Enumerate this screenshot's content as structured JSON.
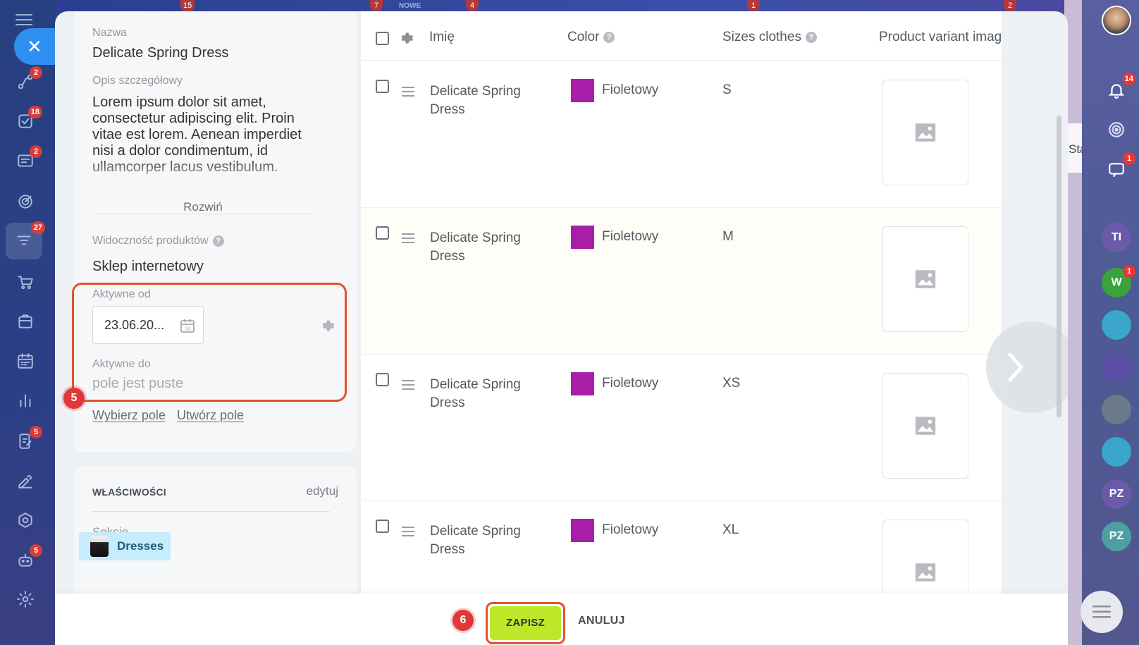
{
  "top_strip": {
    "badges": [
      "15",
      "7",
      "4",
      "1",
      "2"
    ],
    "new_label": "NOWE"
  },
  "left_rail": {
    "items": [
      {
        "icon": "deals-icon",
        "badge": "2"
      },
      {
        "icon": "tasks-icon",
        "badge": "18"
      },
      {
        "icon": "feed-icon",
        "badge": "2"
      },
      {
        "icon": "target-icon",
        "badge": ""
      },
      {
        "icon": "funnel-icon",
        "badge": "27"
      },
      {
        "icon": "cart-icon",
        "badge": ""
      },
      {
        "icon": "store-icon",
        "badge": ""
      },
      {
        "icon": "calendar-icon",
        "badge": ""
      },
      {
        "icon": "analytics-icon",
        "badge": ""
      },
      {
        "icon": "edit-doc-icon",
        "badge": "5"
      },
      {
        "icon": "sign-icon",
        "badge": ""
      },
      {
        "icon": "hexagon-icon",
        "badge": ""
      },
      {
        "icon": "robot-icon",
        "badge": "5"
      },
      {
        "icon": "settings-icon",
        "badge": ""
      }
    ]
  },
  "right_rail": {
    "notification_badge": "14",
    "chat_badge": "1",
    "behind_text": "Stawka poda",
    "avatars": [
      {
        "initials": "TI",
        "color": "#6a5aa8",
        "badge": ""
      },
      {
        "initials": "W",
        "color": "#3aa33a",
        "badge": "1"
      },
      {
        "initials": "",
        "color": "#3aa6c9",
        "badge": ""
      },
      {
        "initials": "",
        "color": "#5b4fa8",
        "badge": ""
      },
      {
        "initials": "",
        "color": "#6b7a8a",
        "badge": ""
      },
      {
        "initials": "",
        "color": "#3aa6c9",
        "badge": ""
      },
      {
        "initials": "PZ",
        "color": "#6a5aa8",
        "badge": ""
      },
      {
        "initials": "PZ",
        "color": "#4d9fa3",
        "badge": ""
      }
    ]
  },
  "product": {
    "name_label": "Nazwa",
    "name_value": "Delicate Spring Dress",
    "desc_label": "Opis szczegółowy",
    "desc_value": "Lorem ipsum dolor sit amet, consectetur adipiscing elit. Proin vitae est lorem. Aenean imperdiet nisi a dolor condimentum, id ullamcorper lacus vestibulum.",
    "expand": "Rozwiń",
    "visibility_label": "Widoczność produktów",
    "visibility_value": "Sklep internetowy",
    "active_from_label": "Aktywne od",
    "active_from_value": "23.06.20...",
    "active_to_label": "Aktywne do",
    "active_to_placeholder": "pole jest puste",
    "choose_field": "Wybierz pole",
    "create_field": "Utwórz pole",
    "step_5": "5"
  },
  "properties": {
    "title": "WŁAŚCIWOŚCI",
    "edit": "edytuj",
    "sections_label": "Sekcje",
    "section_tag": "Dresses"
  },
  "table": {
    "columns": [
      "Imię",
      "Color",
      "Sizes clothes",
      "Product variant images"
    ],
    "rows": [
      {
        "name": "Delicate Spring Dress",
        "color_name": "Fioletowy",
        "color_hex": "#a81ea8",
        "size": "S"
      },
      {
        "name": "Delicate Spring Dress",
        "color_name": "Fioletowy",
        "color_hex": "#a81ea8",
        "size": "M"
      },
      {
        "name": "Delicate Spring Dress",
        "color_name": "Fioletowy",
        "color_hex": "#a81ea8",
        "size": "XS"
      },
      {
        "name": "Delicate Spring Dress",
        "color_name": "Fioletowy",
        "color_hex": "#a81ea8",
        "size": "XL"
      }
    ]
  },
  "footer": {
    "save": "ZAPISZ",
    "cancel": "ANULUJ",
    "step_6": "6"
  },
  "colors": {
    "accent_highlight": "#e0532e",
    "save_green": "#bde82a",
    "badge_red": "#e0373a"
  }
}
